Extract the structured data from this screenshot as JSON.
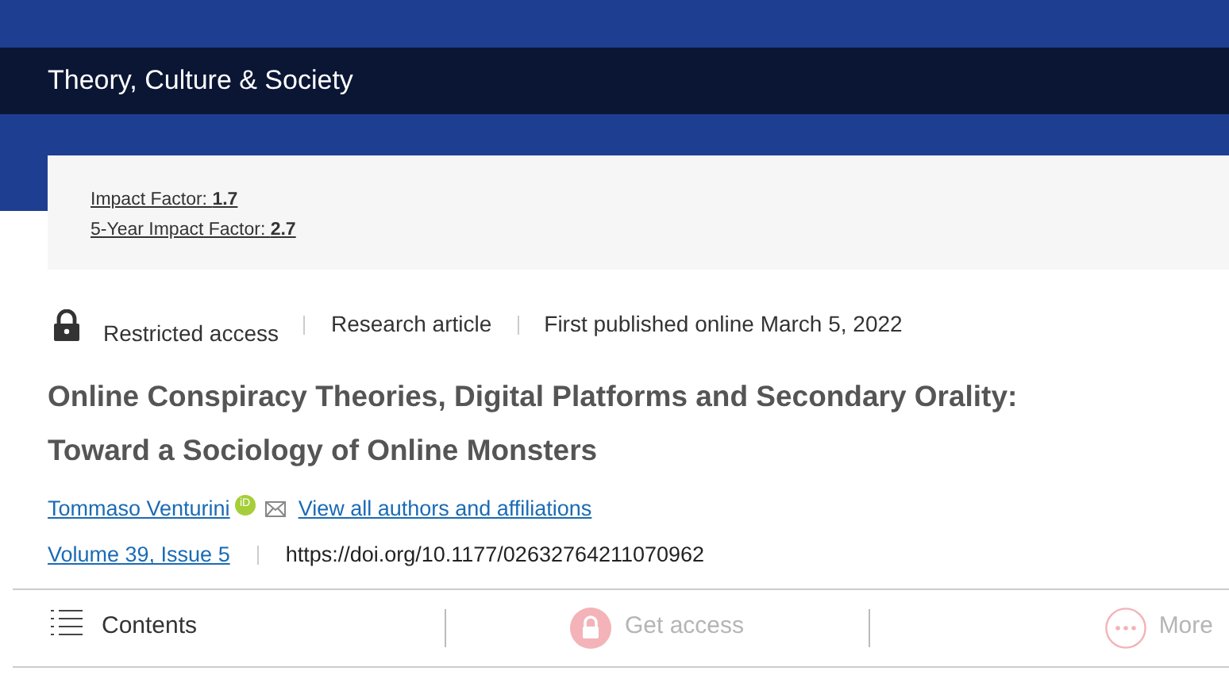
{
  "journal": {
    "title": "Theory, Culture & Society"
  },
  "metrics": [
    {
      "label": "Impact Factor: ",
      "value": "1.7"
    },
    {
      "label": "5-Year Impact Factor: ",
      "value": "2.7"
    }
  ],
  "meta": {
    "access": "Restricted access",
    "type": "Research article",
    "published": "First published online March 5, 2022"
  },
  "article_title": [
    "Online Conspiracy Theories, Digital Platforms and Secondary Orality:",
    "Toward a Sociology of Online Monsters"
  ],
  "authors": {
    "name": "Tommaso Venturini",
    "orcid_badge": "iD",
    "view_all": "View all authors and affiliations"
  },
  "issue": {
    "volume": "Volume 39, Issue 5",
    "doi": "https://doi.org/10.1177/02632764211070962"
  },
  "toolbar": [
    {
      "kind": "contents",
      "label": "Contents",
      "disabled": false
    },
    {
      "kind": "access",
      "label": "Get access",
      "disabled": true
    },
    {
      "kind": "more",
      "label": "More",
      "disabled": true
    }
  ]
}
